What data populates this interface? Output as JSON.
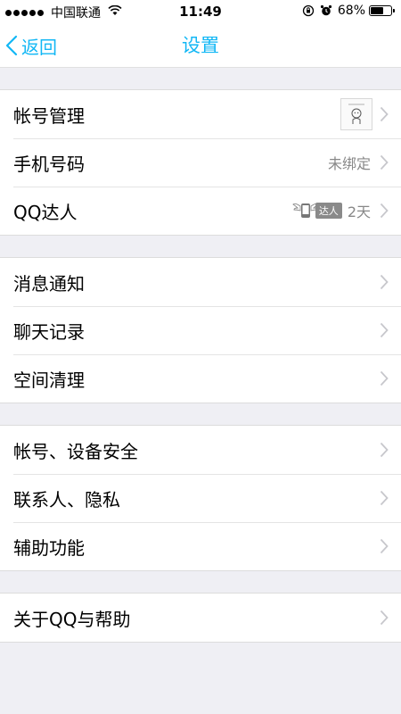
{
  "status_bar": {
    "carrier": "中国联通",
    "time": "11:49",
    "battery": "68%",
    "battery_level": 0.68
  },
  "nav": {
    "back_label": "返回",
    "title": "设置"
  },
  "groups": [
    {
      "items": [
        {
          "label": "帐号管理",
          "value": ""
        },
        {
          "label": "手机号码",
          "value": "未绑定"
        },
        {
          "label": "QQ达人",
          "value": "2天",
          "badge": "达人"
        }
      ]
    },
    {
      "items": [
        {
          "label": "消息通知",
          "value": ""
        },
        {
          "label": "聊天记录",
          "value": ""
        },
        {
          "label": "空间清理",
          "value": ""
        }
      ]
    },
    {
      "items": [
        {
          "label": "帐号、设备安全",
          "value": ""
        },
        {
          "label": "联系人、隐私",
          "value": ""
        },
        {
          "label": "辅助功能",
          "value": ""
        }
      ]
    },
    {
      "items": [
        {
          "label": "关于QQ与帮助",
          "value": ""
        }
      ]
    }
  ],
  "colors": {
    "accent": "#12b7f5",
    "background": "#efeff4"
  }
}
